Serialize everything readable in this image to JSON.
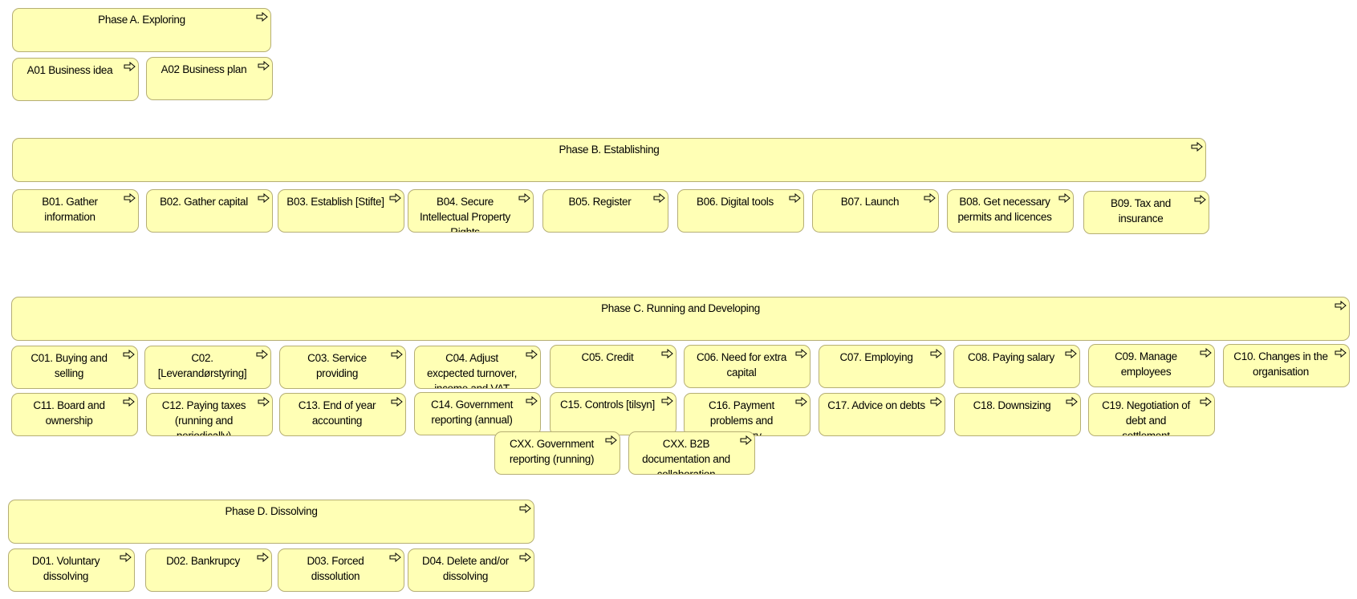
{
  "diagram": {
    "type": "capability-map",
    "accent_fill": "#ffffb5",
    "border_color": "#b5ae74",
    "element_icon": "right-arrow-outline-icon",
    "phases": [
      {
        "id": "A",
        "title": [
          "Phase A. Exploring"
        ],
        "items": [
          {
            "code": "A01",
            "lines": [
              "A01 Business idea"
            ]
          },
          {
            "code": "A02",
            "lines": [
              "A02 Business plan"
            ]
          }
        ]
      },
      {
        "id": "B",
        "title": [
          "Phase B. Establishing"
        ],
        "items": [
          {
            "code": "B01",
            "lines": [
              "B01. Gather",
              "information"
            ]
          },
          {
            "code": "B02",
            "lines": [
              "B02. Gather capital"
            ]
          },
          {
            "code": "B03",
            "lines": [
              "B03. Establish [Stifte]"
            ]
          },
          {
            "code": "B04",
            "lines": [
              "B04. Secure",
              "Intellectual Property",
              "Rights"
            ]
          },
          {
            "code": "B05",
            "lines": [
              "B05. Register"
            ]
          },
          {
            "code": "B06",
            "lines": [
              "B06. Digital tools"
            ]
          },
          {
            "code": "B07",
            "lines": [
              "B07. Launch"
            ]
          },
          {
            "code": "B08",
            "lines": [
              "B08. Get necessary",
              "permits and licences"
            ]
          },
          {
            "code": "B09",
            "lines": [
              "B09. Tax and",
              "insurance"
            ]
          }
        ]
      },
      {
        "id": "C",
        "title": [
          "Phase C. Running and Developing"
        ],
        "items": [
          {
            "code": "C01",
            "lines": [
              "C01. Buying and",
              "selling"
            ]
          },
          {
            "code": "C02",
            "lines": [
              "C02.",
              "[Leverandørstyring]"
            ]
          },
          {
            "code": "C03",
            "lines": [
              "C03. Service",
              "providing"
            ]
          },
          {
            "code": "C04",
            "lines": [
              "C04. Adjust",
              "excpected turnover,",
              "income and VAT"
            ]
          },
          {
            "code": "C05",
            "lines": [
              "C05. Credit"
            ]
          },
          {
            "code": "C06",
            "lines": [
              "C06. Need for extra",
              "capital"
            ]
          },
          {
            "code": "C07",
            "lines": [
              "C07. Employing"
            ]
          },
          {
            "code": "C08",
            "lines": [
              "C08. Paying salary"
            ]
          },
          {
            "code": "C09",
            "lines": [
              "C09. Manage",
              "employees"
            ]
          },
          {
            "code": "C10",
            "lines": [
              "C10. Changes in the",
              "organisation"
            ]
          },
          {
            "code": "C11",
            "lines": [
              "C11. Board and",
              "ownership"
            ]
          },
          {
            "code": "C12",
            "lines": [
              "C12. Paying taxes",
              "(running and",
              "periodically)"
            ]
          },
          {
            "code": "C13",
            "lines": [
              "C13. End of year",
              "accounting"
            ]
          },
          {
            "code": "C14",
            "lines": [
              "C14. Government",
              "reporting (annual)"
            ]
          },
          {
            "code": "C15",
            "lines": [
              "C15. Controls [tilsyn]"
            ]
          },
          {
            "code": "C16",
            "lines": [
              "C16. Payment",
              "problems and",
              "recovery"
            ]
          },
          {
            "code": "C17",
            "lines": [
              "C17. Advice on debts"
            ]
          },
          {
            "code": "C18",
            "lines": [
              "C18. Downsizing"
            ]
          },
          {
            "code": "C19",
            "lines": [
              "C19. Negotiation of",
              "debt and",
              "settlement"
            ]
          },
          {
            "code": "CXX-gov",
            "lines": [
              "CXX. Government",
              "reporting (running)"
            ]
          },
          {
            "code": "CXX-b2b",
            "lines": [
              "CXX. B2B",
              "documentation and",
              "collaboration"
            ]
          }
        ]
      },
      {
        "id": "D",
        "title": [
          "Phase D. Dissolving"
        ],
        "items": [
          {
            "code": "D01",
            "lines": [
              "D01. Voluntary",
              "dissolving"
            ]
          },
          {
            "code": "D02",
            "lines": [
              "D02. Bankrupcy"
            ]
          },
          {
            "code": "D03",
            "lines": [
              "D03. Forced",
              "dissolution"
            ]
          },
          {
            "code": "D04",
            "lines": [
              "D04. Delete and/or",
              "dissolving"
            ]
          }
        ]
      }
    ]
  }
}
